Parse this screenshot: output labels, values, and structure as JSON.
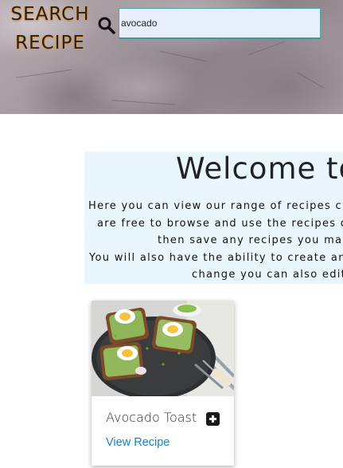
{
  "header": {
    "logo_line1": "SEARCH",
    "logo_line2": "RECIPE",
    "search_icon": "search-icon",
    "search_value": "avocado"
  },
  "welcome": {
    "title": "Welcome to",
    "lines": [
      "Here you can view our range of recipes cr",
      "are free to browse and use the recipes o",
      "then save any recipes you may",
      "You will also have the ability to create an",
      "change you can also edit"
    ]
  },
  "recipe_card": {
    "title": "Avocado Toast",
    "add_icon": "plus-square-icon",
    "link_label": "View Recipe"
  },
  "colors": {
    "search_bg": "#e8effc",
    "search_border": "#4aa8a0",
    "welcome_bg": "#eaf6fd",
    "link": "#1a82c3",
    "logo_glow": "#d9a05a"
  }
}
